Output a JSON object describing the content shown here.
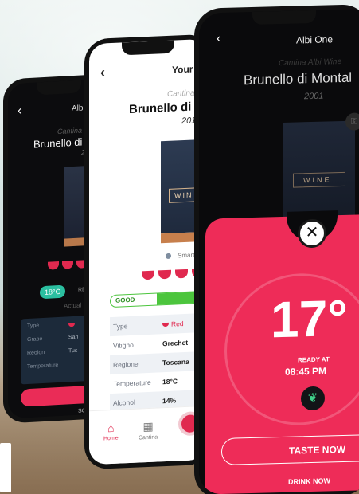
{
  "phone_left": {
    "back_icon": "chevron-left",
    "title": "Albi",
    "cantina": "Cantina",
    "wine": "Brunello di",
    "year": "2",
    "temperature_badge": "18°C",
    "ready_label": "REA",
    "actual_label": "Actual te",
    "table": [
      {
        "key": "Type",
        "value": ""
      },
      {
        "key": "Grape",
        "value": "San"
      },
      {
        "key": "Region",
        "value": "Tus"
      },
      {
        "key": "Temperature",
        "value": ""
      }
    ],
    "button_label": "SE",
    "footer_label": "SCH"
  },
  "phone_middle": {
    "back_icon": "chevron-left",
    "title": "Your W",
    "cantina": "Cantina",
    "wine": "Brunello di M",
    "year": "2011",
    "bottle_label": "WIN",
    "smart_label": "Smart",
    "good_label": "GOOD",
    "good_level_percent": 58,
    "table": [
      {
        "key": "Type",
        "value": "Red",
        "red": true
      },
      {
        "key": "Vitigno",
        "value": "Grechet"
      },
      {
        "key": "Regione",
        "value": "Toscana"
      },
      {
        "key": "Temperature",
        "value": "18°C"
      },
      {
        "key": "Alcohol",
        "value": "14%"
      }
    ],
    "tabs": {
      "home": "Home",
      "cantina": "Cantina"
    }
  },
  "phone_front": {
    "back_icon": "chevron-left",
    "title": "Albi One",
    "cantina": "Cantina Albi Wine",
    "wine": "Brunello di Montal",
    "year": "2001",
    "bottle_label": "WINE",
    "sheet": {
      "close_icon": "close",
      "temperature": "17°",
      "ready_at_label": "READY AT",
      "ready_time": "08:45 PM",
      "leaf_icon": "leaf",
      "taste_button": "TASTE NOW",
      "drink_button": "DRINK NOW"
    },
    "accent_color": "#ee2c58"
  }
}
